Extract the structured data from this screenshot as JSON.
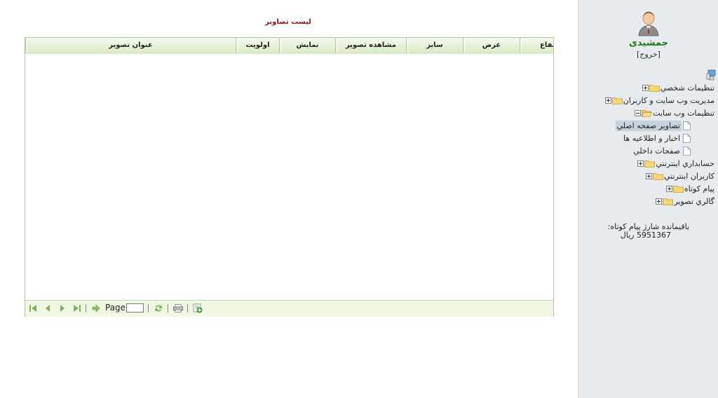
{
  "header": {
    "title": "ليست تصاوير"
  },
  "grid": {
    "columns": [
      "عنوان تصوير",
      "اولويت",
      "نمايش",
      "مشاهده تصوير",
      "سايز",
      "عرض",
      "ارتفاع"
    ],
    "rows": []
  },
  "pager": {
    "page_label": "Page",
    "page_value": ""
  },
  "user": {
    "name": "جمشیدی",
    "logout_label": "[خروج]"
  },
  "tree": {
    "nodes": [
      {
        "label": "تنظيمات شخصي",
        "expanded": false
      },
      {
        "label": "مديريت وب سايت و كاربران",
        "expanded": false
      },
      {
        "label": "تنظيمات وب سايت",
        "expanded": true,
        "children": [
          {
            "label": "تصاوير صفحه اصلي",
            "selected": true
          },
          {
            "label": "اخبار و اطلاعيه ها",
            "selected": false
          },
          {
            "label": "صفحات داخلي",
            "selected": false
          }
        ]
      },
      {
        "label": "حسابداري اينترنتي",
        "expanded": false
      },
      {
        "label": "كاربران اينترنتي",
        "expanded": false
      },
      {
        "label": "پيام كوتاه",
        "expanded": false
      },
      {
        "label": "گالري تصوير",
        "expanded": false
      }
    ]
  },
  "sms_balance": {
    "label": "باقیمانده شارژ پیام کوتاه:",
    "value": "5951367 ریال"
  },
  "colors": {
    "title": "#8b1a1a",
    "username": "#167a16",
    "sidebar_bg": "#e8ebed",
    "grid_header": "#d9ebc5",
    "grid_footer": "#eef7e2"
  },
  "icons": {
    "avatar": "user-avatar-icon",
    "root": "computer-icon",
    "folder": "folder-icon",
    "page": "page-icon",
    "first": "first-page-icon",
    "prev": "prev-page-icon",
    "next": "next-page-icon",
    "last": "last-page-icon",
    "go": "go-arrow-icon",
    "refresh": "refresh-icon",
    "print": "print-icon",
    "add": "add-record-icon"
  }
}
